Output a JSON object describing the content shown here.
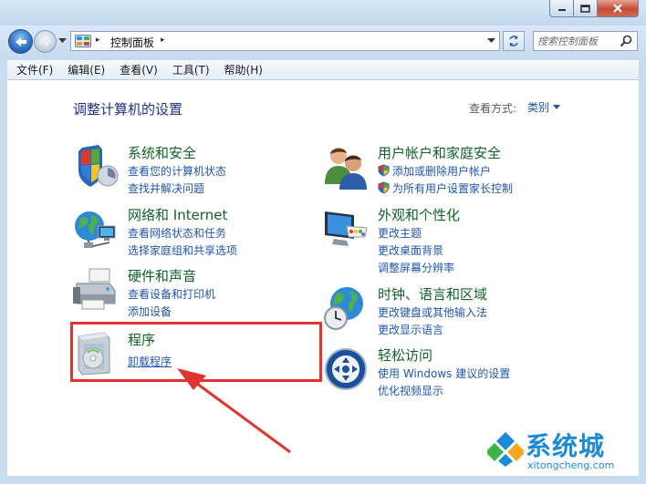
{
  "window": {
    "title": ""
  },
  "address": {
    "path": "控制面板",
    "separator": "▸"
  },
  "search": {
    "placeholder": "搜索控制面板"
  },
  "menu": {
    "items": [
      "文件(F)",
      "编辑(E)",
      "查看(V)",
      "工具(T)",
      "帮助(H)"
    ]
  },
  "main": {
    "title": "调整计算机的设置",
    "view_by_label": "查看方式:",
    "view_by_value": "类别"
  },
  "categories_left": [
    {
      "title": "系统和安全",
      "links": [
        "查看您的计算机状态",
        "查找并解决问题"
      ],
      "icon": "shield-flag-icon"
    },
    {
      "title": "网络和 Internet",
      "links": [
        "查看网络状态和任务",
        "选择家庭组和共享选项"
      ],
      "icon": "network-globe-icon"
    },
    {
      "title": "硬件和声音",
      "links": [
        "查看设备和打印机",
        "添加设备"
      ],
      "icon": "printer-icon"
    },
    {
      "title": "程序",
      "links": [
        "卸载程序"
      ],
      "icon": "program-box-icon"
    }
  ],
  "categories_right": [
    {
      "title": "用户帐户和家庭安全",
      "links": [
        "添加或删除用户帐户",
        "为所有用户设置家长控制"
      ],
      "icon": "users-icon",
      "shielded": true
    },
    {
      "title": "外观和个性化",
      "links": [
        "更改主题",
        "更改桌面背景",
        "调整屏幕分辨率"
      ],
      "icon": "monitor-palette-icon"
    },
    {
      "title": "时钟、语言和区域",
      "links": [
        "更改键盘或其他输入法",
        "更改显示语言"
      ],
      "icon": "globe-clock-icon"
    },
    {
      "title": "轻松访问",
      "links": [
        "使用 Windows 建议的设置",
        "优化视频显示"
      ],
      "icon": "ease-of-access-icon"
    }
  ],
  "watermark": {
    "text": "系统城",
    "sub": "xitongcheng.com"
  },
  "colors": {
    "highlight": "#e0352e",
    "link": "#1f56b3",
    "category_title": "#0f6326"
  }
}
